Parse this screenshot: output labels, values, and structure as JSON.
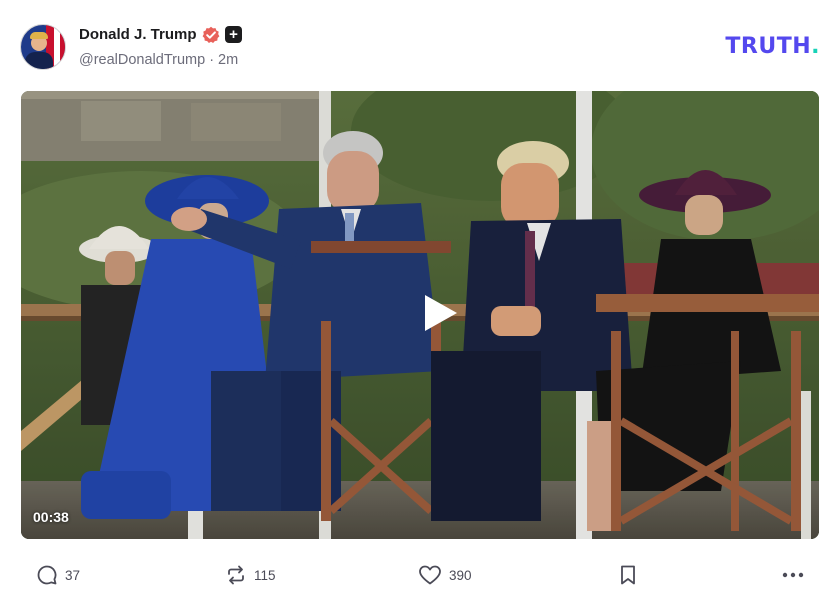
{
  "post": {
    "author": {
      "display_name": "Donald J. Trump",
      "handle": "@realDonaldTrump",
      "separator": "·",
      "time_ago": "2m",
      "verified_icon": "verified-badge-icon",
      "plus_icon": "plus-badge-icon"
    },
    "brand": {
      "logo_text": "TRUTH",
      "logo_dot": ".",
      "primary_color": "#5448ee",
      "accent_color": "#17d2b7"
    },
    "video": {
      "duration": "00:38",
      "play_icon": "play-icon"
    },
    "actions": {
      "reply_count": "37",
      "retruth_count": "115",
      "like_count": "390",
      "reply_icon": "reply-icon",
      "retruth_icon": "retruth-icon",
      "like_icon": "heart-icon",
      "bookmark_icon": "bookmark-icon",
      "more_icon": "more-icon"
    }
  }
}
